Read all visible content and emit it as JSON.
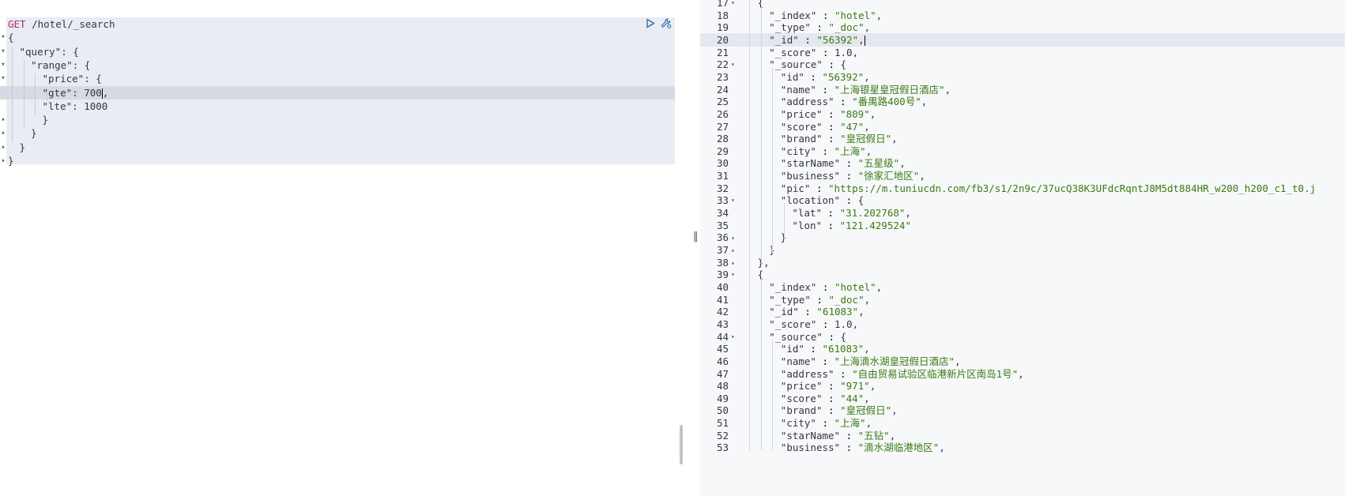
{
  "request": {
    "method": "GET",
    "path": "/hotel/_search",
    "lines": [
      {
        "indent": 0,
        "text": "{"
      },
      {
        "indent": 1,
        "key": "\"query\"",
        "rest": ": {"
      },
      {
        "indent": 2,
        "key": "\"range\"",
        "rest": ": {"
      },
      {
        "indent": 3,
        "key": "\"price\"",
        "rest": ": {"
      },
      {
        "indent": 3,
        "key": "\"gte\"",
        "rest": ": 700",
        "suffix": ","
      },
      {
        "indent": 3,
        "key": "\"lte\"",
        "rest": ": 1000"
      },
      {
        "indent": 3,
        "text": "}"
      },
      {
        "indent": 2,
        "text": "}"
      },
      {
        "indent": 1,
        "text": "}"
      },
      {
        "indent": 0,
        "text": "}"
      }
    ]
  },
  "response": {
    "lines": [
      {
        "n": "17",
        "fold": "▾",
        "indent": 1,
        "text": "{"
      },
      {
        "n": "18",
        "indent": 2,
        "key": "\"_index\"",
        "val": "\"hotel\"",
        "end": ","
      },
      {
        "n": "19",
        "indent": 2,
        "key": "\"_type\"",
        "val": "\"_doc\"",
        "end": ","
      },
      {
        "n": "20",
        "indent": 2,
        "key": "\"_id\"",
        "val": "\"56392\"",
        "end": ",",
        "active": true
      },
      {
        "n": "21",
        "indent": 2,
        "key": "\"_score\"",
        "num": "1.0",
        "end": ","
      },
      {
        "n": "22",
        "fold": "▾",
        "indent": 2,
        "key": "\"_source\"",
        "open": "{"
      },
      {
        "n": "23",
        "indent": 3,
        "key": "\"id\"",
        "val": "\"56392\"",
        "end": ","
      },
      {
        "n": "24",
        "indent": 3,
        "key": "\"name\"",
        "val": "\"上海银星皇冠假日酒店\"",
        "end": ","
      },
      {
        "n": "25",
        "indent": 3,
        "key": "\"address\"",
        "val": "\"番禺路400号\"",
        "end": ","
      },
      {
        "n": "26",
        "indent": 3,
        "key": "\"price\"",
        "val": "\"809\"",
        "end": ","
      },
      {
        "n": "27",
        "indent": 3,
        "key": "\"score\"",
        "val": "\"47\"",
        "end": ","
      },
      {
        "n": "28",
        "indent": 3,
        "key": "\"brand\"",
        "val": "\"皇冠假日\"",
        "end": ","
      },
      {
        "n": "29",
        "indent": 3,
        "key": "\"city\"",
        "val": "\"上海\"",
        "end": ","
      },
      {
        "n": "30",
        "indent": 3,
        "key": "\"starName\"",
        "val": "\"五星级\"",
        "end": ","
      },
      {
        "n": "31",
        "indent": 3,
        "key": "\"business\"",
        "val": "\"徐家汇地区\"",
        "end": ","
      },
      {
        "n": "32",
        "indent": 3,
        "key": "\"pic\"",
        "val": "\"https://m.tuniucdn.com/fb3/s1/2n9c/37ucQ38K3UFdcRqntJ8M5dt884HR_w200_h200_c1_t0.j",
        "end": ""
      },
      {
        "n": "33",
        "fold": "▾",
        "indent": 3,
        "key": "\"location\"",
        "open": "{"
      },
      {
        "n": "34",
        "indent": 4,
        "key": "\"lat\"",
        "val": "\"31.202768\"",
        "end": ","
      },
      {
        "n": "35",
        "indent": 4,
        "key": "\"lon\"",
        "val": "\"121.429524\"",
        "end": ""
      },
      {
        "n": "36",
        "fold": "▴",
        "indent": 3,
        "text": "}"
      },
      {
        "n": "37",
        "fold": "▴",
        "indent": 2,
        "text": "}"
      },
      {
        "n": "38",
        "fold": "▴",
        "indent": 1,
        "text": "},"
      },
      {
        "n": "39",
        "fold": "▾",
        "indent": 1,
        "text": "{"
      },
      {
        "n": "40",
        "indent": 2,
        "key": "\"_index\"",
        "val": "\"hotel\"",
        "end": ","
      },
      {
        "n": "41",
        "indent": 2,
        "key": "\"_type\"",
        "val": "\"_doc\"",
        "end": ","
      },
      {
        "n": "42",
        "indent": 2,
        "key": "\"_id\"",
        "val": "\"61083\"",
        "end": ","
      },
      {
        "n": "43",
        "indent": 2,
        "key": "\"_score\"",
        "num": "1.0",
        "end": ","
      },
      {
        "n": "44",
        "fold": "▾",
        "indent": 2,
        "key": "\"_source\"",
        "open": "{"
      },
      {
        "n": "45",
        "indent": 3,
        "key": "\"id\"",
        "val": "\"61083\"",
        "end": ","
      },
      {
        "n": "46",
        "indent": 3,
        "key": "\"name\"",
        "val": "\"上海滴水湖皇冠假日酒店\"",
        "end": ","
      },
      {
        "n": "47",
        "indent": 3,
        "key": "\"address\"",
        "val": "\"自由贸易试验区临港新片区南岛1号\"",
        "end": ","
      },
      {
        "n": "48",
        "indent": 3,
        "key": "\"price\"",
        "val": "\"971\"",
        "end": ","
      },
      {
        "n": "49",
        "indent": 3,
        "key": "\"score\"",
        "val": "\"44\"",
        "end": ","
      },
      {
        "n": "50",
        "indent": 3,
        "key": "\"brand\"",
        "val": "\"皇冠假日\"",
        "end": ","
      },
      {
        "n": "51",
        "indent": 3,
        "key": "\"city\"",
        "val": "\"上海\"",
        "end": ","
      },
      {
        "n": "52",
        "indent": 3,
        "key": "\"starName\"",
        "val": "\"五钻\"",
        "end": ","
      },
      {
        "n": "53",
        "indent": 3,
        "key": "\"business\"",
        "val": "\"滴水湖临港地区\"",
        "end": ","
      }
    ]
  },
  "icons": {
    "run": "play-icon",
    "settings": "wrench-icon",
    "resize": "resize-handle-icon"
  },
  "colors": {
    "method": "#b0286e",
    "string": "#3a7b14",
    "request_bg": "#e9ecf3",
    "active_line": "#d6dae4"
  }
}
